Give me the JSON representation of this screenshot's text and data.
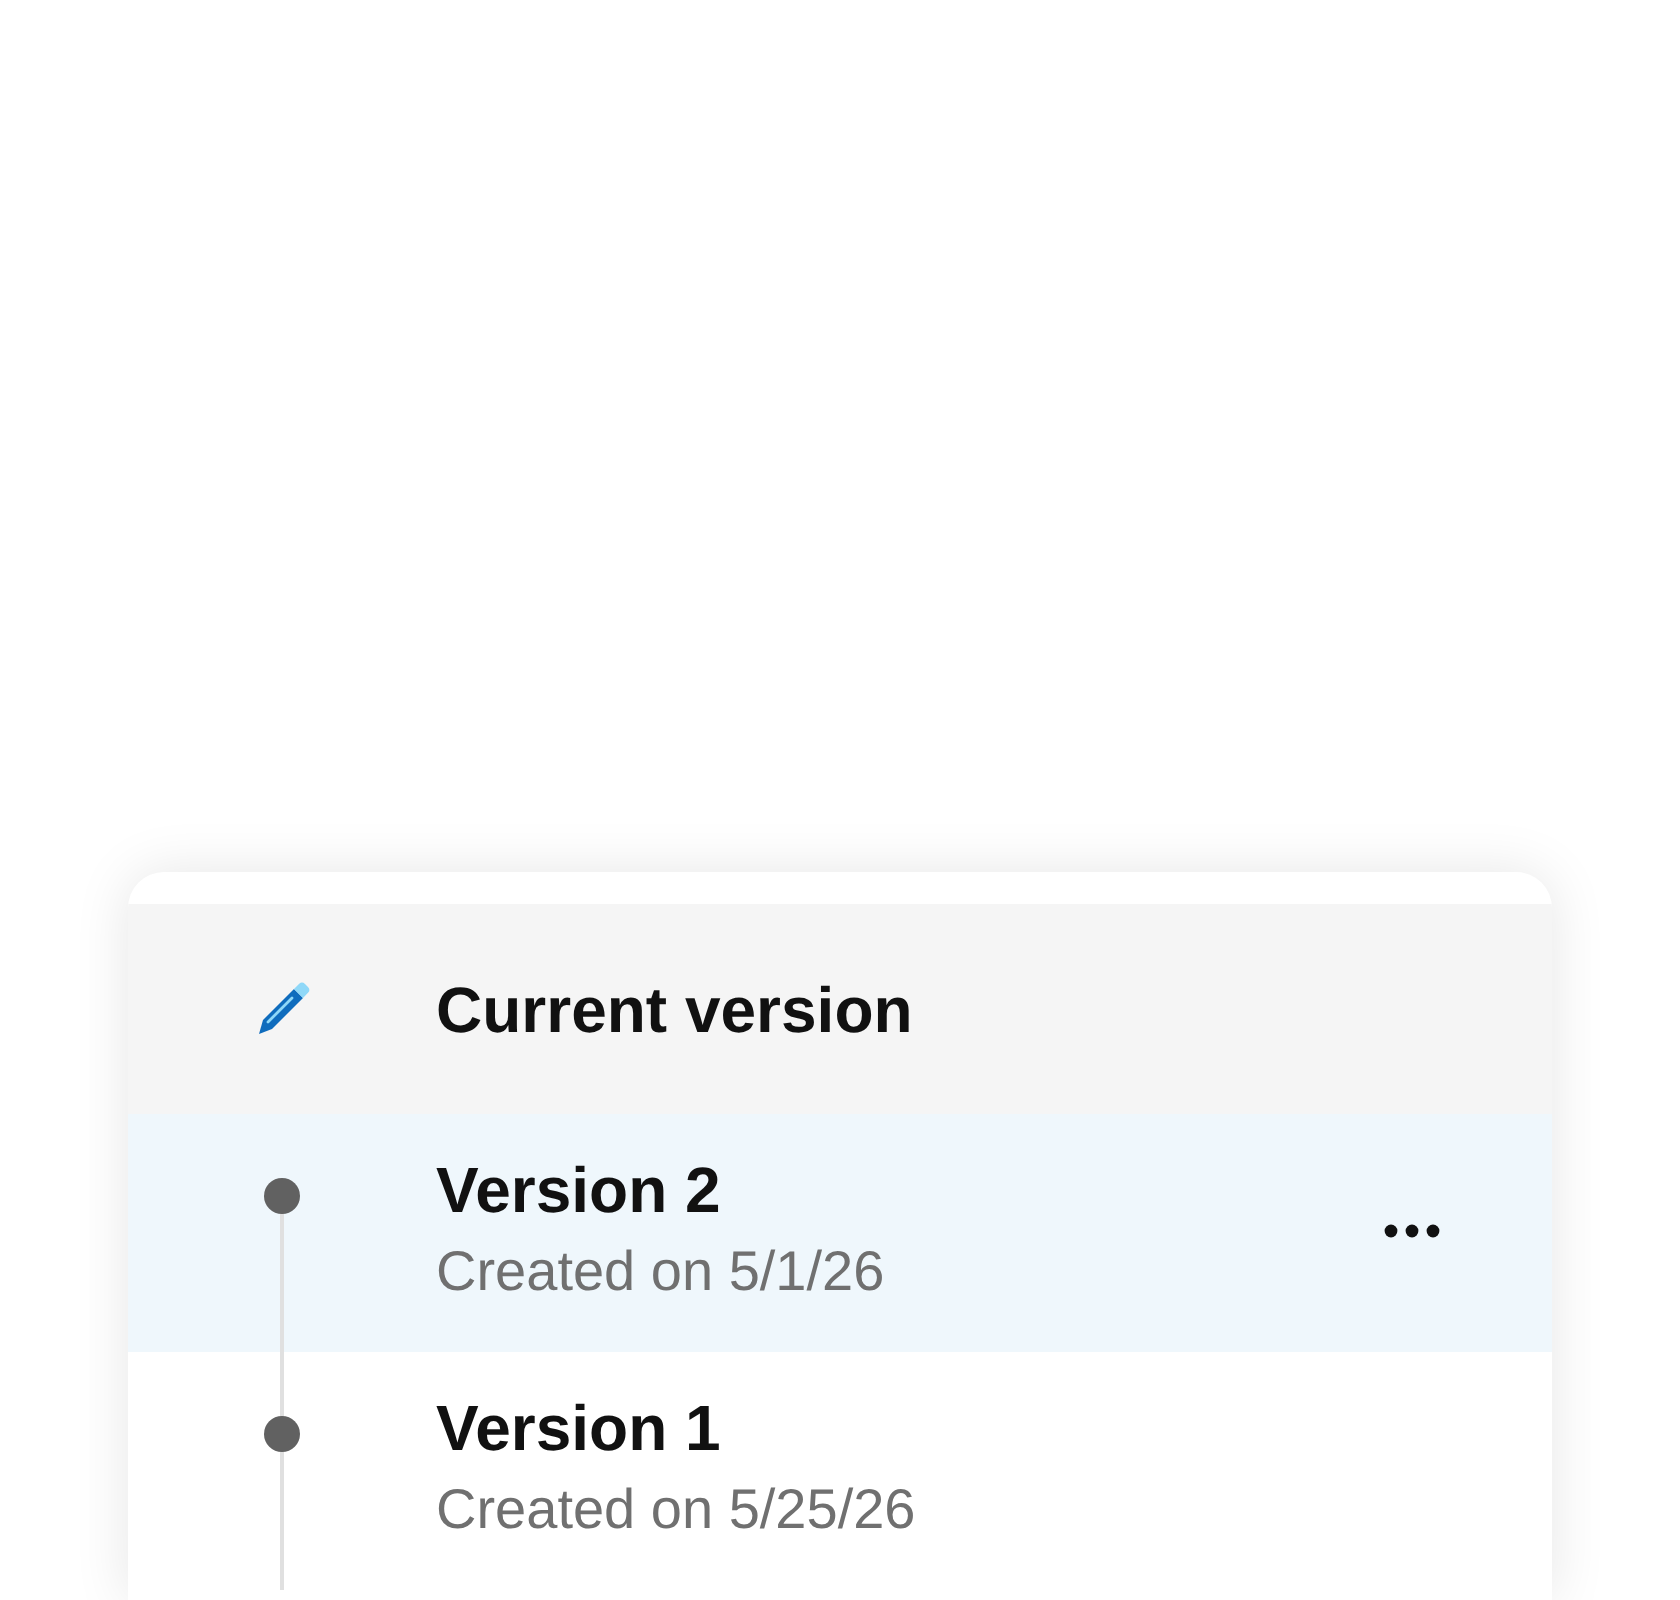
{
  "current": {
    "label": "Current version"
  },
  "versions": [
    {
      "title": "Version 2",
      "subtitle": "Created on 5/1/26",
      "selected": true
    },
    {
      "title": "Version 1",
      "subtitle": "Created on 5/25/26",
      "selected": false
    }
  ]
}
